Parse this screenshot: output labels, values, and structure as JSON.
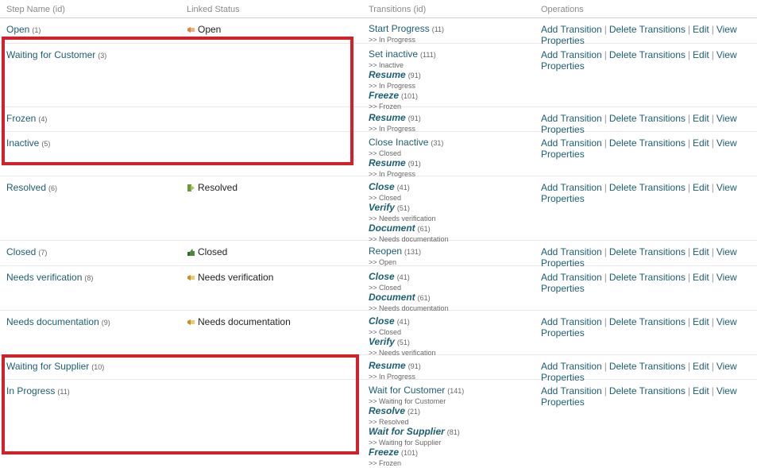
{
  "headers": {
    "step_name": "Step Name (id)",
    "linked_status": "Linked Status",
    "transitions": "Transitions (id)",
    "operations": "Operations"
  },
  "operations": {
    "add": "Add Transition",
    "delete": "Delete Transitions",
    "edit": "Edit",
    "view": "View Properties"
  },
  "highlight_color": "#d42129",
  "link_color": "#1a5f73",
  "rows": [
    {
      "name": "Open",
      "id": "(1)",
      "status": "Open",
      "status_icon": "open-status-icon",
      "transitions": [
        {
          "name": "Start Progress",
          "id": "(11)",
          "dest": ">> In Progress",
          "global": false
        }
      ]
    },
    {
      "name": "Waiting for Customer",
      "id": "(3)",
      "status": "",
      "status_icon": "",
      "transitions": [
        {
          "name": "Set inactive",
          "id": "(111)",
          "dest": ">> Inactive",
          "global": false
        },
        {
          "name": "Resume",
          "id": "(91)",
          "dest": ">> In Progress",
          "global": true
        },
        {
          "name": "Freeze",
          "id": "(101)",
          "dest": ">> Frozen",
          "global": true
        }
      ]
    },
    {
      "name": "Frozen",
      "id": "(4)",
      "status": "",
      "status_icon": "",
      "transitions": [
        {
          "name": "Resume",
          "id": "(91)",
          "dest": ">> In Progress",
          "global": true
        }
      ]
    },
    {
      "name": "Inactive",
      "id": "(5)",
      "status": "",
      "status_icon": "",
      "transitions": [
        {
          "name": "Close Inactive",
          "id": "(31)",
          "dest": ">> Closed",
          "global": false
        },
        {
          "name": "Resume",
          "id": "(91)",
          "dest": ">> In Progress",
          "global": true
        }
      ]
    },
    {
      "name": "Resolved",
      "id": "(6)",
      "status": "Resolved",
      "status_icon": "resolved-status-icon",
      "transitions": [
        {
          "name": "Close",
          "id": "(41)",
          "dest": ">> Closed",
          "global": true
        },
        {
          "name": "Verify",
          "id": "(51)",
          "dest": ">> Needs verification",
          "global": true
        },
        {
          "name": "Document",
          "id": "(61)",
          "dest": ">> Needs documentation",
          "global": true
        }
      ]
    },
    {
      "name": "Closed",
      "id": "(7)",
      "status": "Closed",
      "status_icon": "closed-status-icon",
      "transitions": [
        {
          "name": "Reopen",
          "id": "(131)",
          "dest": ">> Open",
          "global": false
        }
      ]
    },
    {
      "name": "Needs verification",
      "id": "(8)",
      "status": "Needs verification",
      "status_icon": "needs-verification-status-icon",
      "transitions": [
        {
          "name": "Close",
          "id": "(41)",
          "dest": ">> Closed",
          "global": true
        },
        {
          "name": "Document",
          "id": "(61)",
          "dest": ">> Needs documentation",
          "global": true
        }
      ]
    },
    {
      "name": "Needs documentation",
      "id": "(9)",
      "status": "Needs documentation",
      "status_icon": "needs-documentation-status-icon",
      "transitions": [
        {
          "name": "Close",
          "id": "(41)",
          "dest": ">> Closed",
          "global": true
        },
        {
          "name": "Verify",
          "id": "(51)",
          "dest": ">> Needs verification",
          "global": true
        }
      ]
    },
    {
      "name": "Waiting for Supplier",
      "id": "(10)",
      "status": "",
      "status_icon": "",
      "transitions": [
        {
          "name": "Resume",
          "id": "(91)",
          "dest": ">> In Progress",
          "global": true
        }
      ]
    },
    {
      "name": "In Progress",
      "id": "(11)",
      "status": "",
      "status_icon": "",
      "transitions": [
        {
          "name": "Wait for Customer",
          "id": "(141)",
          "dest": ">> Waiting for Customer",
          "global": false
        },
        {
          "name": "Resolve",
          "id": "(21)",
          "dest": ">> Resolved",
          "global": true
        },
        {
          "name": "Wait for Supplier",
          "id": "(81)",
          "dest": ">> Waiting for Supplier",
          "global": true
        },
        {
          "name": "Freeze",
          "id": "(101)",
          "dest": ">> Frozen",
          "global": true
        }
      ]
    }
  ]
}
